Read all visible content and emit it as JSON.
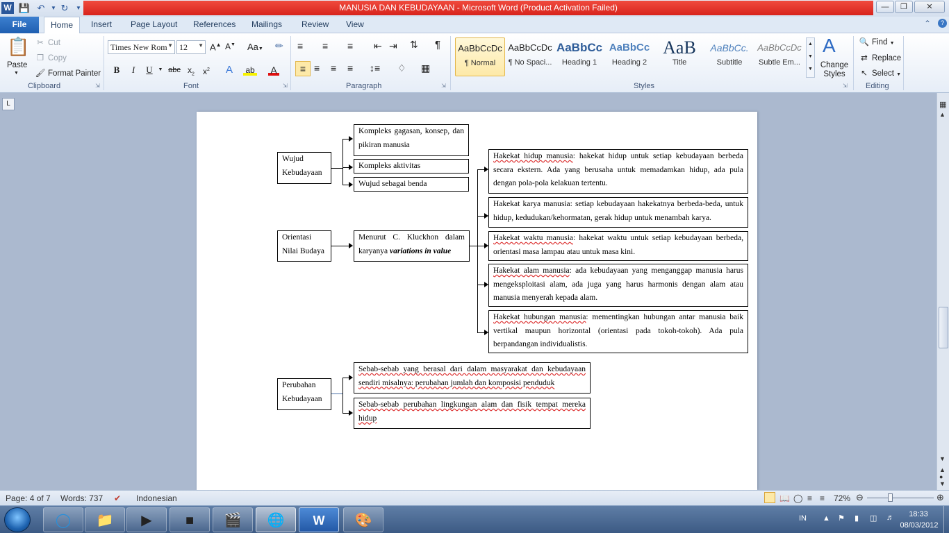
{
  "window": {
    "title": "MANUSIA DAN KEBUDAYAAN  -  Microsoft Word (Product Activation Failed)"
  },
  "tabs": [
    "File",
    "Home",
    "Insert",
    "Page Layout",
    "References",
    "Mailings",
    "Review",
    "View"
  ],
  "clipboard": {
    "paste": "Paste",
    "cut": "Cut",
    "copy": "Copy",
    "format_painter": "Format Painter",
    "label": "Clipboard"
  },
  "font": {
    "family": "Times New Rom",
    "size": "12",
    "label": "Font"
  },
  "paragraph": {
    "label": "Paragraph"
  },
  "styles": {
    "label": "Styles",
    "items": [
      {
        "sample": "AaBbCcDc",
        "name": "¶ Normal"
      },
      {
        "sample": "AaBbCcDc",
        "name": "¶ No Spaci..."
      },
      {
        "sample": "AaBbCc",
        "name": "Heading 1"
      },
      {
        "sample": "AaBbCc",
        "name": "Heading 2"
      },
      {
        "sample": "AaB",
        "name": "Title"
      },
      {
        "sample": "AaBbCc.",
        "name": "Subtitle"
      },
      {
        "sample": "AaBbCcDc",
        "name": "Subtle Em..."
      }
    ],
    "change_styles": "Change Styles"
  },
  "editing": {
    "find": "Find",
    "replace": "Replace",
    "select": "Select",
    "label": "Editing"
  },
  "diagram": {
    "wujud": "Wujud Kebudayaan",
    "wujud_items": [
      "Kompleks gagasan, konsep, dan pikiran manusia",
      "Kompleks aktivitas",
      "Wujud sebagai benda"
    ],
    "orientasi": "Orientasi Nilai Budaya",
    "kluckhon_a": "Menurut C. Kluckhon dalam karyanya",
    "kluckhon_b": "variations in value",
    "hakekat": [
      {
        "u": "Hakekat hidup manusia",
        "t": ": hakekat hidup untuk setiap kebudayaan berbeda secara ekstern. Ada yang berusaha untuk memadamkan hidup, ada pula dengan pola-pola kelakuan tertentu."
      },
      {
        "u": "",
        "t": "Hakekat karya manusia: setiap kebudayaan hakekatnya berbeda-beda, untuk hidup, kedudukan/kehormatan, gerak hidup untuk menambah karya."
      },
      {
        "u": "Hakekat waktu  manusia",
        "t": ": hakekat waktu untuk setiap kebudayaan berbeda, orientasi masa lampau atau untuk masa kini."
      },
      {
        "u": "Hakekat alam manusia",
        "t": ": ada kebudayaan yang menganggap manusia harus mengeksploitasi alam, ada juga yang harus harmonis dengan alam atau manusia menyerah kepada alam."
      },
      {
        "u": "Hakekat hubungan manusia",
        "t": ": mementingkan hubungan antar manusia baik vertikal maupun horizontal (orientasi pada tokoh-tokoh). Ada pula berpandangan individualistis."
      }
    ],
    "perubahan": "Perubahan Kebudayaan",
    "sebab": [
      "Sebab-sebab yang berasal dari dalam masyarakat dan kebudayaan sendiri misalnya: perubahan jumlah dan komposisi penduduk",
      "Sebab-sebab perubahan lingkungan alam dan fisik tempat mereka hidup"
    ]
  },
  "status": {
    "page": "Page: 4 of 7",
    "words": "Words: 737",
    "language": "Indonesian",
    "zoom": "72%"
  },
  "tray": {
    "lang": "IN",
    "time": "18:33",
    "date": "08/03/2012"
  }
}
